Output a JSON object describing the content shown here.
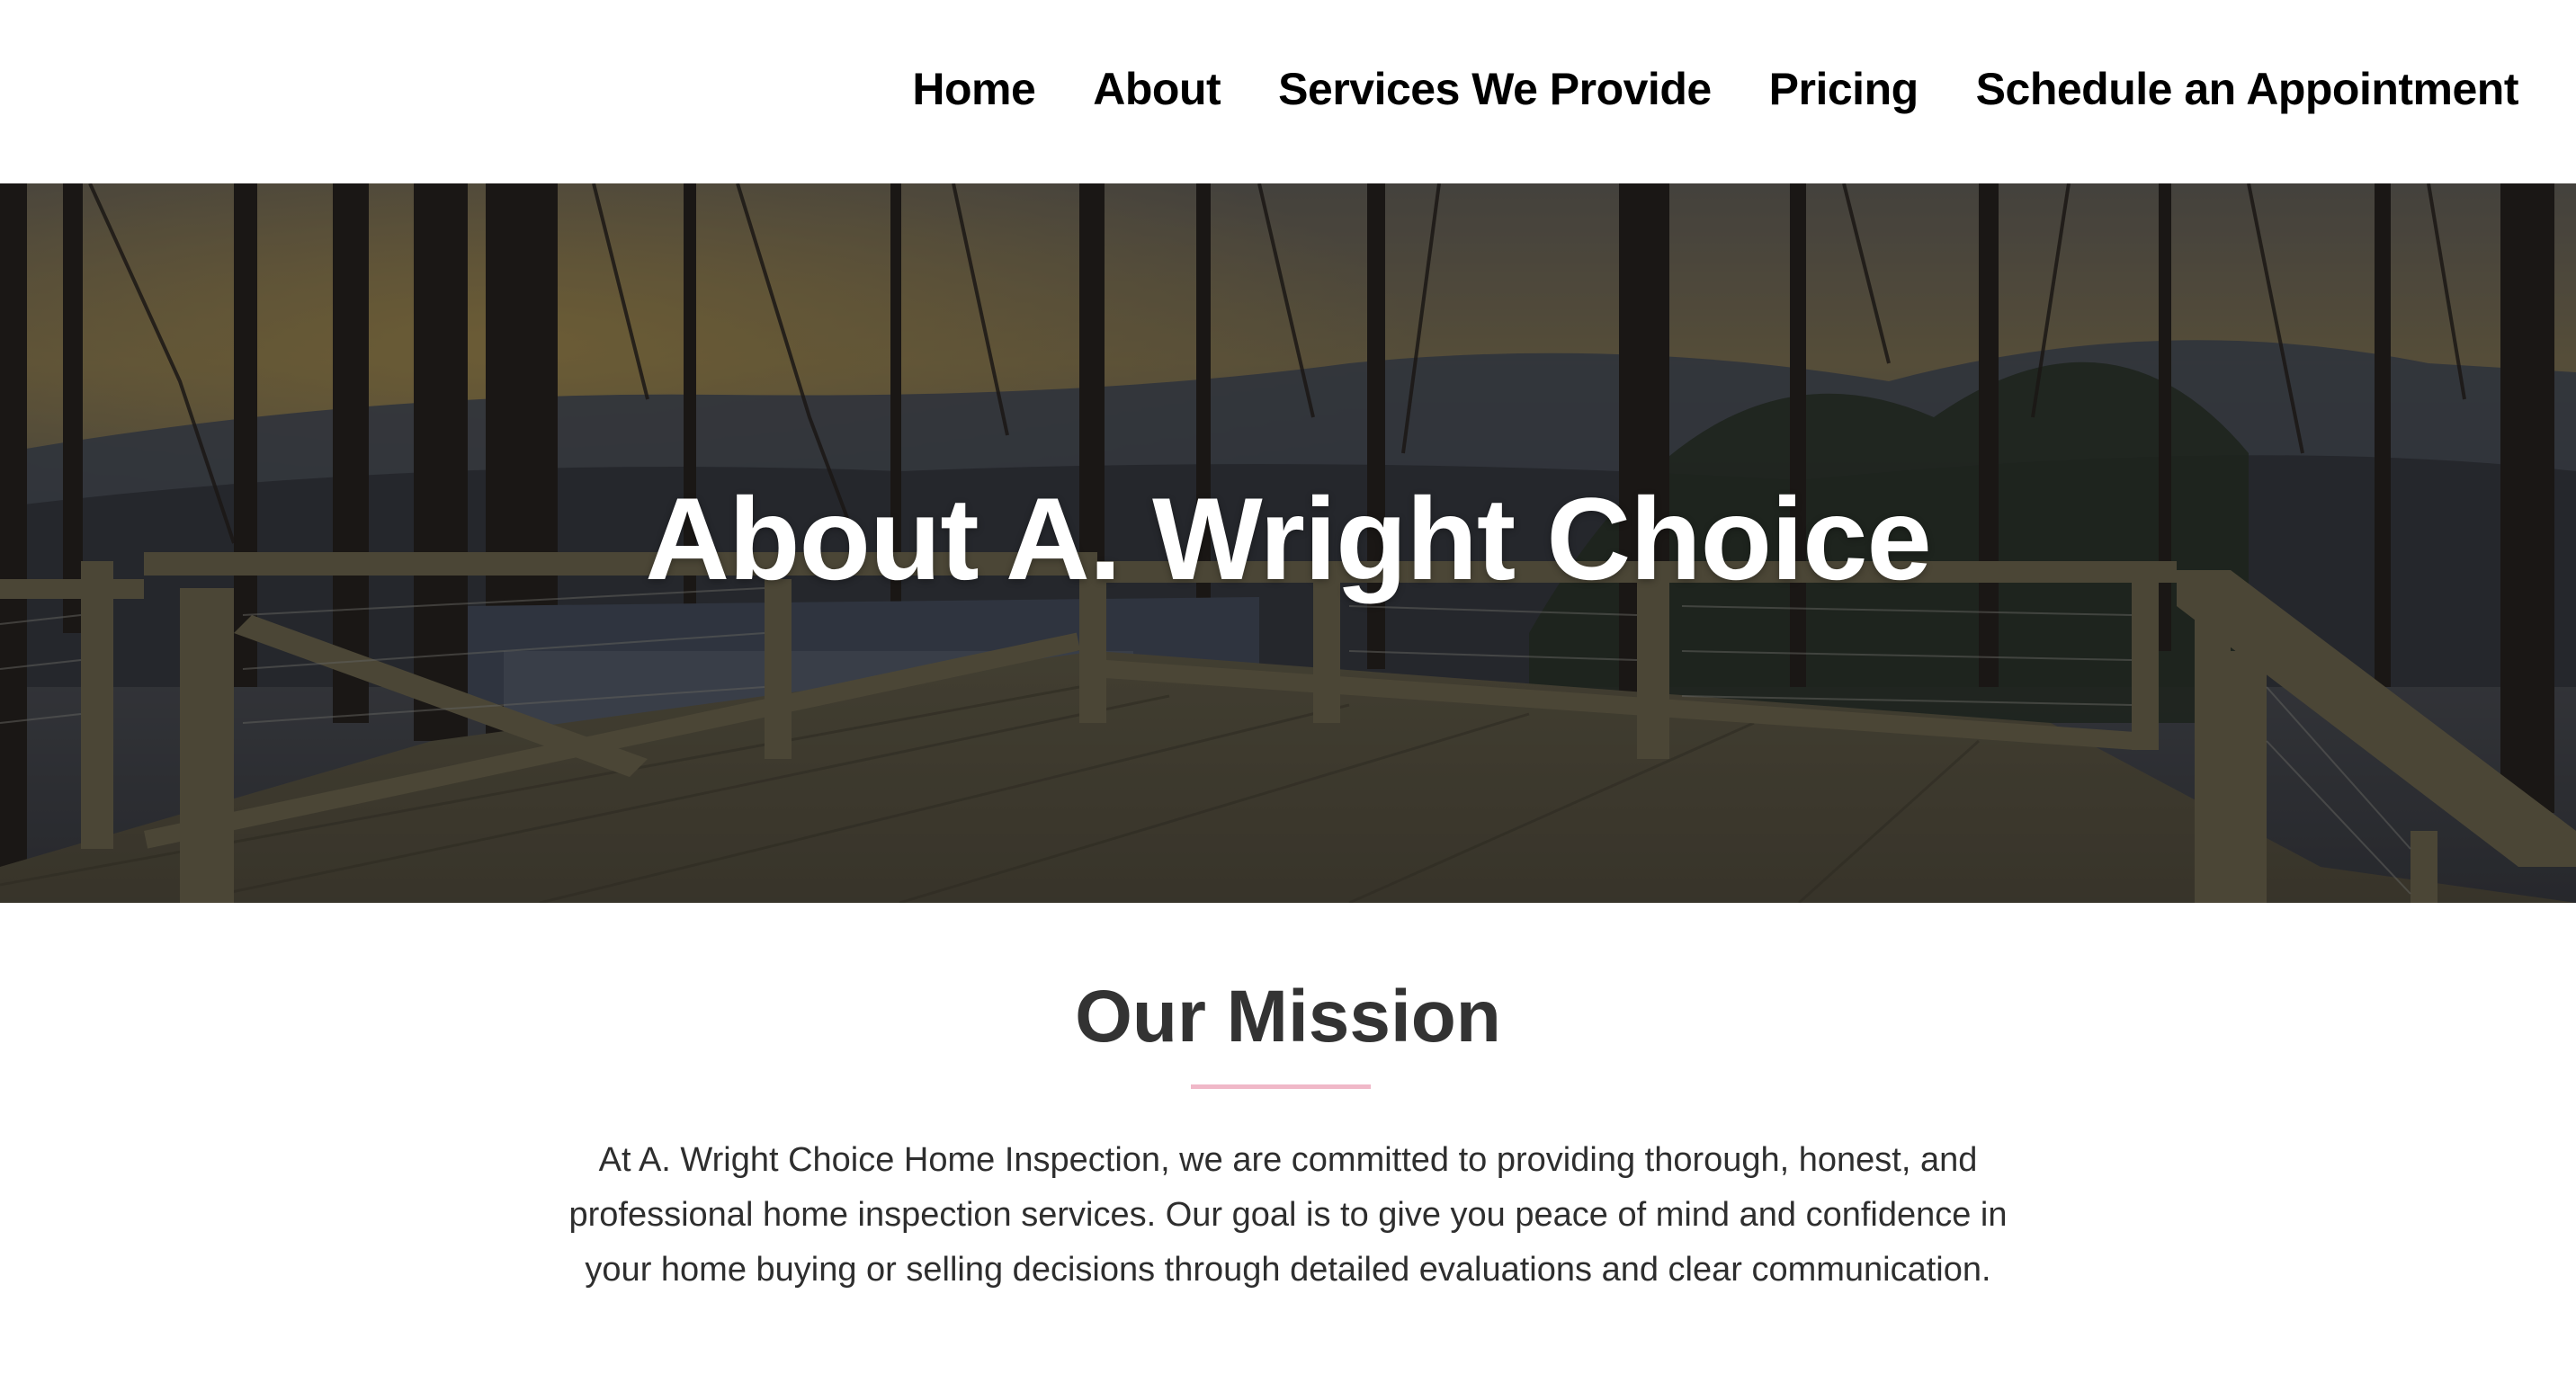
{
  "nav": {
    "items": [
      {
        "label": "Home"
      },
      {
        "label": "About"
      },
      {
        "label": "Services We Provide"
      },
      {
        "label": "Pricing"
      },
      {
        "label": "Schedule an Appointment"
      }
    ]
  },
  "hero": {
    "title": "About A. Wright Choice"
  },
  "mission": {
    "title": "Our Mission",
    "divider_color": "#f0b8c8",
    "text": "At A. Wright Choice Home Inspection, we are committed to providing thorough, honest, and professional home inspection services. Our goal is to give you peace of mind and confidence in your home buying or selling decisions through detailed evaluations and clear communication."
  }
}
